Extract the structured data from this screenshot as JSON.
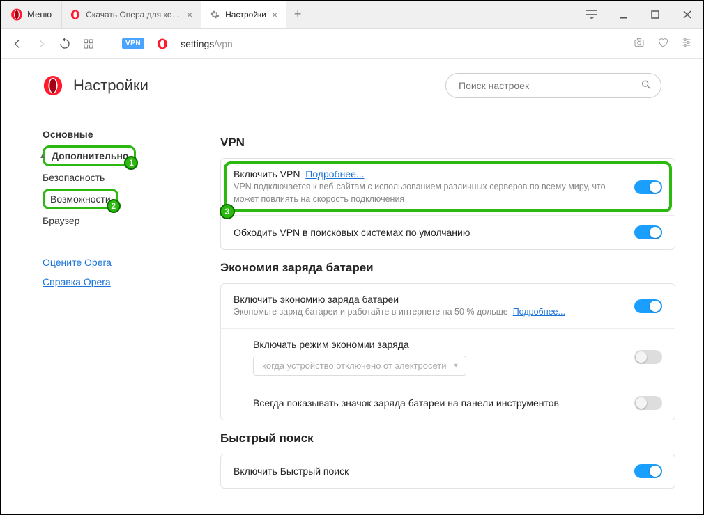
{
  "titlebar": {
    "menu_label": "Меню",
    "tabs": [
      {
        "label": "Скачать Опера для компь"
      },
      {
        "label": "Настройки"
      }
    ]
  },
  "addressbar": {
    "vpn_badge": "VPN",
    "url_host": "settings",
    "url_path": "/vpn"
  },
  "header": {
    "title": "Настройки",
    "search_placeholder": "Поиск настроек"
  },
  "sidebar": {
    "items": [
      {
        "label": "Основные",
        "bold": true
      },
      {
        "label": "Дополнительно",
        "bold": true,
        "ann": "1",
        "chev": "up"
      },
      {
        "label": "Безопасность"
      },
      {
        "label": "Возможности",
        "ann": "2"
      },
      {
        "label": "Браузер"
      }
    ],
    "links": [
      {
        "label": "Оцените Opera"
      },
      {
        "label": "Справка Opera"
      }
    ]
  },
  "sections": {
    "vpn": {
      "title": "VPN",
      "row1_title": "Включить VPN",
      "row1_learn_more": "Подробнее...",
      "row1_desc": "VPN подключается к веб-сайтам с использованием различных серверов по всему миру, что может повлиять на скорость подключения",
      "row1_ann_badge": "3",
      "row2_title": "Обходить VPN в поисковых системах по умолчанию"
    },
    "battery": {
      "title": "Экономия заряда батареи",
      "row1_title": "Включить экономию заряда батареи",
      "row1_desc": "Экономьте заряд батареи и работайте в интернете на 50 % дольше",
      "row1_learn_more": "Подробнее...",
      "row2_title": "Включать режим экономии заряда",
      "row2_select": "когда устройство отключено от электросети",
      "row3_title": "Всегда показывать значок заряда батареи на панели инструментов"
    },
    "quicksearch": {
      "title": "Быстрый поиск",
      "row1_title": "Включить Быстрый поиск"
    }
  }
}
